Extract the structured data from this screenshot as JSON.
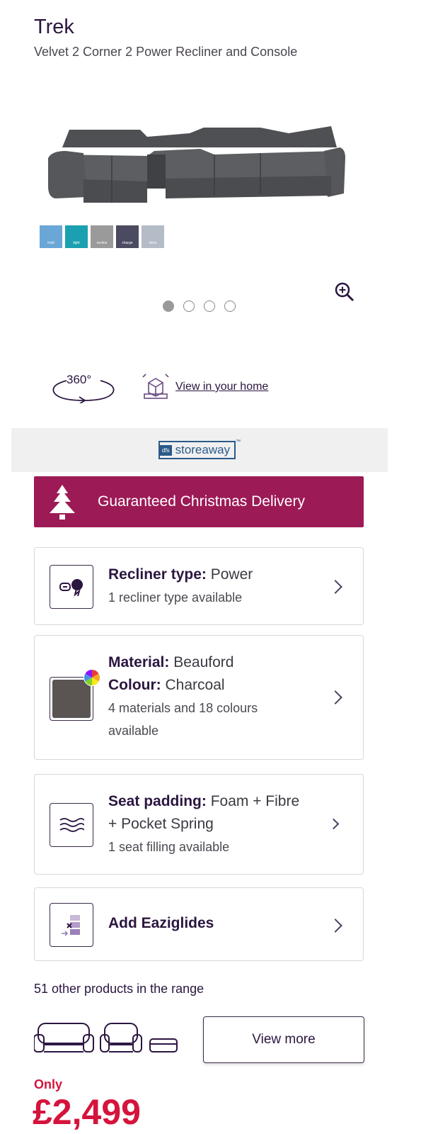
{
  "product": {
    "title": "Trek",
    "subtitle": "Velvet 2 Corner 2 Power Recliner and Console"
  },
  "gallery": {
    "feature_icons": [
      {
        "label": "hold",
        "color": "#6aa6d6"
      },
      {
        "label": "light",
        "color": "#1aa0b0"
      },
      {
        "label": "recline",
        "color": "#9a9a9a"
      },
      {
        "label": "charge",
        "color": "#4a4a60"
      },
      {
        "label": "store",
        "color": "#b4bcc8"
      }
    ],
    "slide_count": 4,
    "active_slide": 1
  },
  "view": {
    "v360_label": "360°",
    "ar_label": "View in your home"
  },
  "storeaway": {
    "mark": "dfs",
    "text": "storeaway",
    "tm": "™"
  },
  "banner": {
    "text": "Guaranteed Christmas Delivery",
    "color": "#9c1a55"
  },
  "options": {
    "recliner": {
      "label": "Recliner type:",
      "value": "Power",
      "sub": "1 recliner type available"
    },
    "material": {
      "material_label": "Material:",
      "material_value": "Beauford",
      "colour_label": "Colour:",
      "colour_value": "Charcoal",
      "sub1": "4 materials and 18 colours",
      "sub2": "available"
    },
    "padding": {
      "label": "Seat padding:",
      "value1": "Foam + Fibre",
      "value2": "+ Pocket Spring",
      "sub": "1 seat filling available"
    },
    "eaziglides": {
      "label": "Add Eaziglides"
    }
  },
  "range": {
    "text": "51 other products in the range",
    "button": "View more"
  },
  "price": {
    "prefix": "Only",
    "value": "£2,499",
    "color": "#d4143c"
  }
}
